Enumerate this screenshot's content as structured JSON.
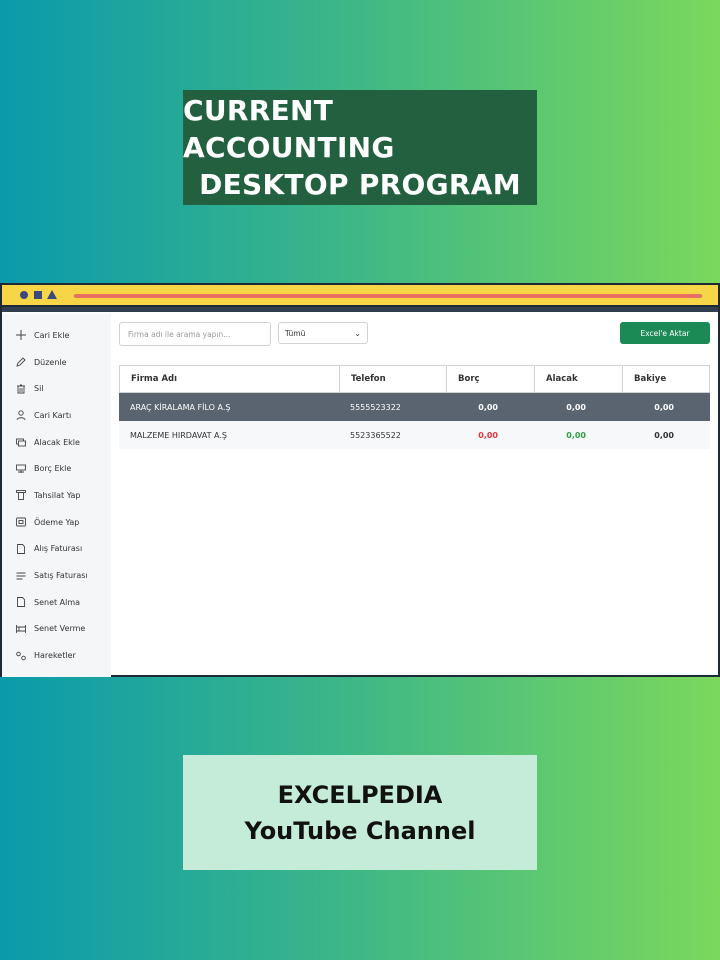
{
  "banner": {
    "line1": "CURRENT ACCOUNTING",
    "line2": "DESKTOP PROGRAM"
  },
  "footer": {
    "line1": "EXCELPEDIA",
    "line2": "YouTube Channel"
  },
  "sidebar": {
    "items": [
      {
        "label": "Cari Ekle",
        "icon": "plus-icon"
      },
      {
        "label": "Düzenle",
        "icon": "pencil-icon"
      },
      {
        "label": "Sil",
        "icon": "trash-icon"
      },
      {
        "label": "Cari Kartı",
        "icon": "user-icon"
      },
      {
        "label": "Alacak Ekle",
        "icon": "receivable-icon"
      },
      {
        "label": "Borç Ekle",
        "icon": "debt-icon"
      },
      {
        "label": "Tahsilat Yap",
        "icon": "collection-icon"
      },
      {
        "label": "Ödeme Yap",
        "icon": "payment-icon"
      },
      {
        "label": "Alış Faturası",
        "icon": "purchase-invoice-icon"
      },
      {
        "label": "Satış Faturası",
        "icon": "sales-invoice-icon"
      },
      {
        "label": "Senet Alma",
        "icon": "document-icon"
      },
      {
        "label": "Senet Verme",
        "icon": "bond-issue-icon"
      },
      {
        "label": "Hareketler",
        "icon": "movements-icon"
      }
    ]
  },
  "toolbar": {
    "search_placeholder": "Firma adı ile arama yapın...",
    "filter_value": "Tümü",
    "export_label": "Excel'e Aktar"
  },
  "table": {
    "headers": [
      "Firma Adı",
      "Telefon",
      "Borç",
      "Alacak",
      "Bakiye"
    ],
    "rows": [
      {
        "firma": "ARAÇ KİRALAMA FİLO A.Ş",
        "telefon": "5555523322",
        "borc": "0,00",
        "alacak": "0,00",
        "bakiye": "0,00"
      },
      {
        "firma": "MALZEME HIRDAVAT A.Ş",
        "telefon": "5523365522",
        "borc": "0,00",
        "alacak": "0,00",
        "bakiye": "0,00"
      }
    ]
  },
  "colors": {
    "titlebar": "#f6d646",
    "export_button": "#1b8a55",
    "selected_row": "#5a6370",
    "debt_text": "#d9363e",
    "credit_text": "#2f9e44"
  }
}
